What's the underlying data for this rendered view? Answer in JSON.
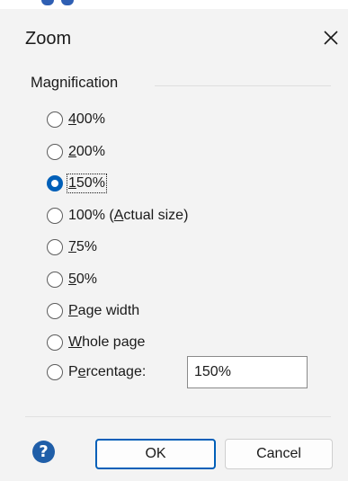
{
  "dialog": {
    "title": "Zoom",
    "close_glyph": "✕",
    "group_label": "Magnification",
    "options": [
      {
        "pre": "",
        "u": "4",
        "post": "00%",
        "checked": false
      },
      {
        "pre": "",
        "u": "2",
        "post": "00%",
        "checked": false
      },
      {
        "pre": "",
        "u": "1",
        "post": "50%",
        "checked": true
      },
      {
        "pre": "100% (",
        "u": "A",
        "post": "ctual size)",
        "checked": false
      },
      {
        "pre": "",
        "u": "7",
        "post": "5%",
        "checked": false
      },
      {
        "pre": "",
        "u": "5",
        "post": "0%",
        "checked": false
      },
      {
        "pre": "",
        "u": "P",
        "post": "age width",
        "checked": false
      },
      {
        "pre": "",
        "u": "W",
        "post": "hole page",
        "checked": false
      },
      {
        "pre": "P",
        "u": "e",
        "post": "rcentage:",
        "checked": false
      }
    ],
    "percentage_value": "150%",
    "help_glyph": "?",
    "ok_label": "OK",
    "cancel_label": "Cancel",
    "colors": {
      "accent": "#005fb8",
      "help": "#1f5ea8",
      "background": "#f3f3f3"
    }
  }
}
